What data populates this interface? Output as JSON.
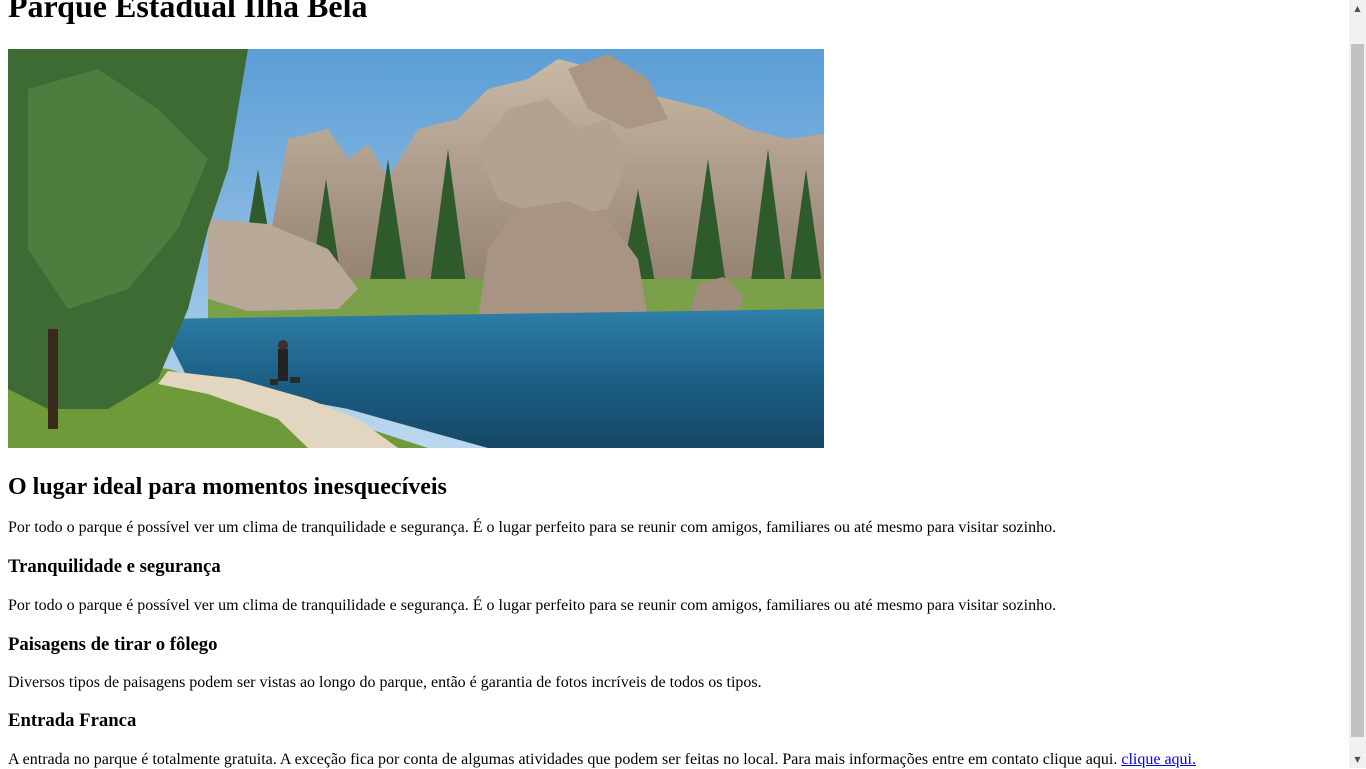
{
  "page": {
    "title": "Parque Estadual Ilha Bela",
    "hero_alt": "Lago com formações rochosas, pinheiros e uma pessoa caminhando com cachorros em uma trilha"
  },
  "sections": {
    "intro": {
      "heading": "O lugar ideal para momentos inesquecíveis",
      "text": "Por todo o parque é possível ver um clima de tranquilidade e segurança. É o lugar perfeito para se reunir com amigos, familiares ou até mesmo para visitar sozinho."
    },
    "safety": {
      "heading": "Tranquilidade e segurança",
      "text": "Por todo o parque é possível ver um clima de tranquilidade e segurança. É o lugar perfeito para se reunir com amigos, familiares ou até mesmo para visitar sozinho."
    },
    "landscapes": {
      "heading": "Paisagens de tirar o fôlego",
      "text": "Diversos tipos de paisagens podem ser vistas ao longo do parque, então é garantia de fotos incríveis de todos os tipos."
    },
    "entry": {
      "heading": "Entrada Franca",
      "text": "A entrada no parque é totalmente gratuita. A exceção fica por conta de algumas atividades que podem ser feitas no local. Para mais informações entre em contato clique aqui. ",
      "link_label": "clique aqui."
    }
  },
  "icons": {
    "scroll_up": "triangle-up-icon",
    "scroll_down": "triangle-down-icon"
  }
}
